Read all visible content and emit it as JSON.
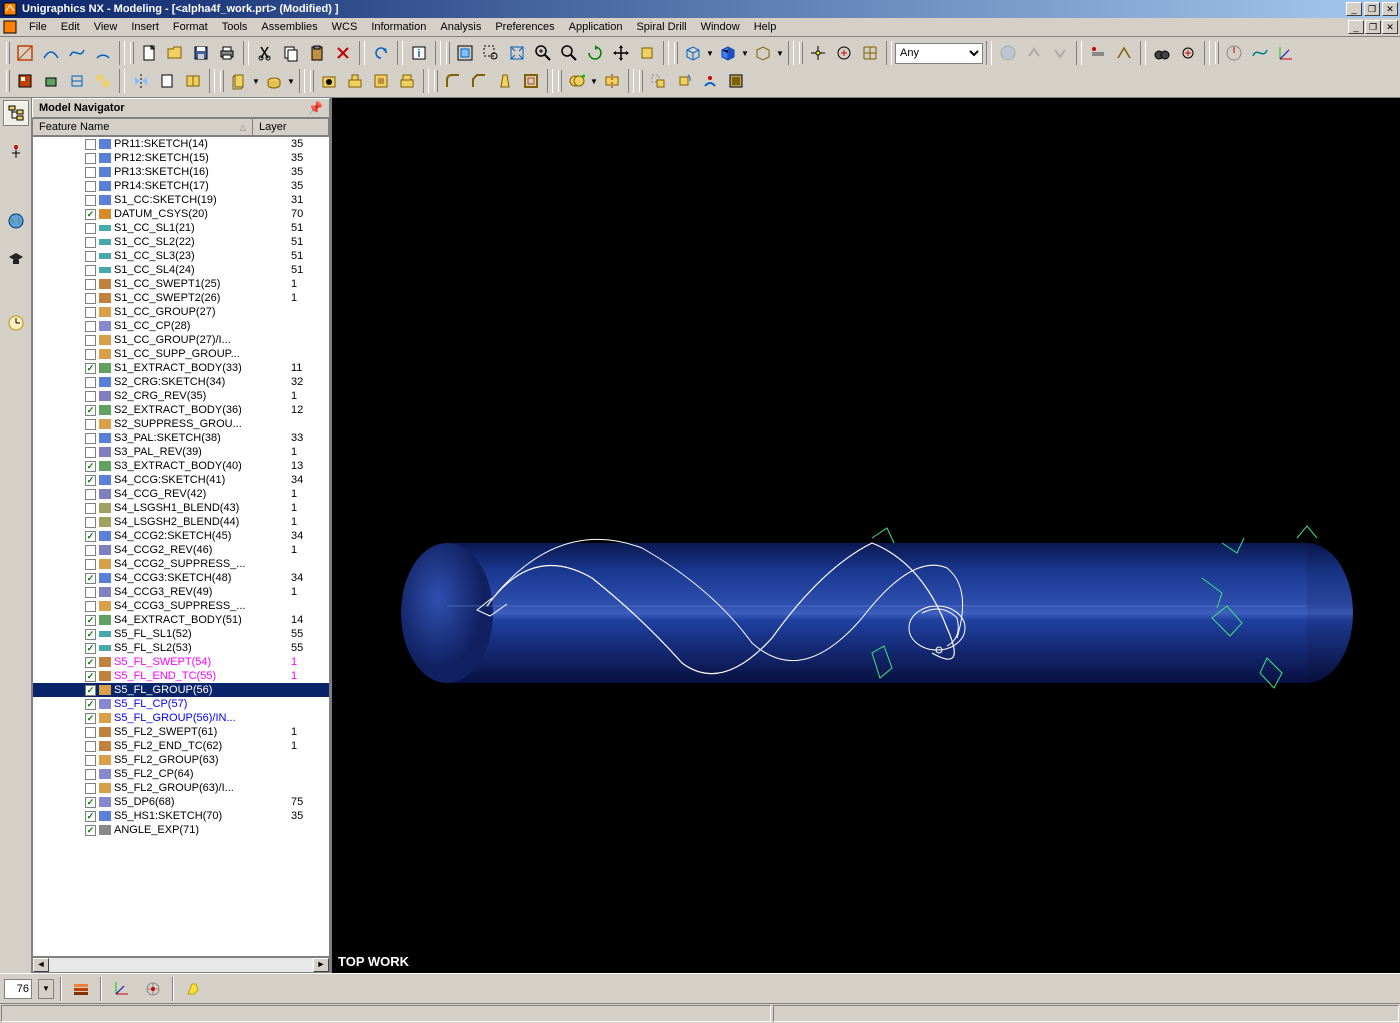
{
  "title": "Unigraphics NX - Modeling - [<alpha4f_work.prt> (Modified) ]",
  "menus": [
    "File",
    "Edit",
    "View",
    "Insert",
    "Format",
    "Tools",
    "Assemblies",
    "WCS",
    "Information",
    "Analysis",
    "Preferences",
    "Application",
    "Spiral Drill",
    "Window",
    "Help"
  ],
  "filter_value": "Any",
  "nav": {
    "title": "Model Navigator",
    "col1": "Feature Name",
    "col2": "Layer"
  },
  "tree": [
    {
      "chk": false,
      "icon": "sketch",
      "name": "PR11:SKETCH(14)",
      "layer": "35"
    },
    {
      "chk": false,
      "icon": "sketch",
      "name": "PR12:SKETCH(15)",
      "layer": "35"
    },
    {
      "chk": false,
      "icon": "sketch",
      "name": "PR13:SKETCH(16)",
      "layer": "35"
    },
    {
      "chk": false,
      "icon": "sketch",
      "name": "PR14:SKETCH(17)",
      "layer": "35"
    },
    {
      "chk": false,
      "icon": "sketch",
      "name": "S1_CC:SKETCH(19)",
      "layer": "31"
    },
    {
      "chk": true,
      "icon": "csys",
      "name": "DATUM_CSYS(20)",
      "layer": "70"
    },
    {
      "chk": false,
      "icon": "wave",
      "name": "S1_CC_SL1(21)",
      "layer": "51"
    },
    {
      "chk": false,
      "icon": "wave",
      "name": "S1_CC_SL2(22)",
      "layer": "51"
    },
    {
      "chk": false,
      "icon": "wave",
      "name": "S1_CC_SL3(23)",
      "layer": "51"
    },
    {
      "chk": false,
      "icon": "wave",
      "name": "S1_CC_SL4(24)",
      "layer": "51"
    },
    {
      "chk": false,
      "icon": "swept",
      "name": "S1_CC_SWEPT1(25)",
      "layer": "1"
    },
    {
      "chk": false,
      "icon": "swept",
      "name": "S1_CC_SWEPT2(26)",
      "layer": "1"
    },
    {
      "chk": false,
      "icon": "group",
      "name": "S1_CC_GROUP(27)",
      "layer": ""
    },
    {
      "chk": false,
      "icon": "cp",
      "name": "S1_CC_CP(28)",
      "layer": ""
    },
    {
      "chk": false,
      "icon": "group",
      "name": "S1_CC_GROUP(27)/I...",
      "layer": ""
    },
    {
      "chk": false,
      "icon": "group",
      "name": "S1_CC_SUPP_GROUP...",
      "layer": ""
    },
    {
      "chk": true,
      "icon": "body",
      "name": "S1_EXTRACT_BODY(33)",
      "layer": "11"
    },
    {
      "chk": false,
      "icon": "sketch",
      "name": "S2_CRG:SKETCH(34)",
      "layer": "32"
    },
    {
      "chk": false,
      "icon": "rev",
      "name": "S2_CRG_REV(35)",
      "layer": "1"
    },
    {
      "chk": true,
      "icon": "body",
      "name": "S2_EXTRACT_BODY(36)",
      "layer": "12"
    },
    {
      "chk": false,
      "icon": "group",
      "name": "S2_SUPPRESS_GROU...",
      "layer": ""
    },
    {
      "chk": false,
      "icon": "sketch",
      "name": "S3_PAL:SKETCH(38)",
      "layer": "33"
    },
    {
      "chk": false,
      "icon": "rev",
      "name": "S3_PAL_REV(39)",
      "layer": "1"
    },
    {
      "chk": true,
      "icon": "body",
      "name": "S3_EXTRACT_BODY(40)",
      "layer": "13"
    },
    {
      "chk": true,
      "icon": "sketch",
      "name": "S4_CCG:SKETCH(41)",
      "layer": "34"
    },
    {
      "chk": false,
      "icon": "rev",
      "name": "S4_CCG_REV(42)",
      "layer": "1"
    },
    {
      "chk": false,
      "icon": "blend",
      "name": "S4_LSGSH1_BLEND(43)",
      "layer": "1"
    },
    {
      "chk": false,
      "icon": "blend",
      "name": "S4_LSGSH2_BLEND(44)",
      "layer": "1"
    },
    {
      "chk": true,
      "icon": "sketch",
      "name": "S4_CCG2:SKETCH(45)",
      "layer": "34"
    },
    {
      "chk": false,
      "icon": "rev",
      "name": "S4_CCG2_REV(46)",
      "layer": "1"
    },
    {
      "chk": false,
      "icon": "group",
      "name": "S4_CCG2_SUPPRESS_...",
      "layer": ""
    },
    {
      "chk": true,
      "icon": "sketch",
      "name": "S4_CCG3:SKETCH(48)",
      "layer": "34"
    },
    {
      "chk": false,
      "icon": "rev",
      "name": "S4_CCG3_REV(49)",
      "layer": "1"
    },
    {
      "chk": false,
      "icon": "group",
      "name": "S4_CCG3_SUPPRESS_...",
      "layer": ""
    },
    {
      "chk": true,
      "icon": "body",
      "name": "S4_EXTRACT_BODY(51)",
      "layer": "14"
    },
    {
      "chk": true,
      "icon": "wave",
      "name": "S5_FL_SL1(52)",
      "layer": "55"
    },
    {
      "chk": true,
      "icon": "wave",
      "name": "S5_FL_SL2(53)",
      "layer": "55"
    },
    {
      "chk": true,
      "icon": "swept",
      "name": "S5_FL_SWEPT(54)",
      "layer": "1",
      "cls": "pink"
    },
    {
      "chk": true,
      "icon": "swept",
      "name": "S5_FL_END_TC(55)",
      "layer": "1",
      "cls": "pink"
    },
    {
      "chk": true,
      "icon": "group",
      "name": "S5_FL_GROUP(56)",
      "layer": "",
      "cls": "selected"
    },
    {
      "chk": true,
      "icon": "cp",
      "name": "S5_FL_CP(57)",
      "layer": "",
      "cls": "blue"
    },
    {
      "chk": true,
      "icon": "group",
      "name": "S5_FL_GROUP(56)/IN...",
      "layer": "",
      "cls": "blue"
    },
    {
      "chk": false,
      "icon": "swept",
      "name": "S5_FL2_SWEPT(61)",
      "layer": "1"
    },
    {
      "chk": false,
      "icon": "swept",
      "name": "S5_FL2_END_TC(62)",
      "layer": "1"
    },
    {
      "chk": false,
      "icon": "group",
      "name": "S5_FL2_GROUP(63)",
      "layer": ""
    },
    {
      "chk": false,
      "icon": "cp",
      "name": "S5_FL2_CP(64)",
      "layer": ""
    },
    {
      "chk": false,
      "icon": "group",
      "name": "S5_FL2_GROUP(63)/I...",
      "layer": ""
    },
    {
      "chk": true,
      "icon": "cp",
      "name": "S5_DP6(68)",
      "layer": "75"
    },
    {
      "chk": true,
      "icon": "sketch",
      "name": "S5_HS1:SKETCH(70)",
      "layer": "35"
    },
    {
      "chk": true,
      "icon": "angle",
      "name": "ANGLE_EXP(71)",
      "layer": ""
    }
  ],
  "viewport_label": "TOP WORK",
  "status_input": "76"
}
